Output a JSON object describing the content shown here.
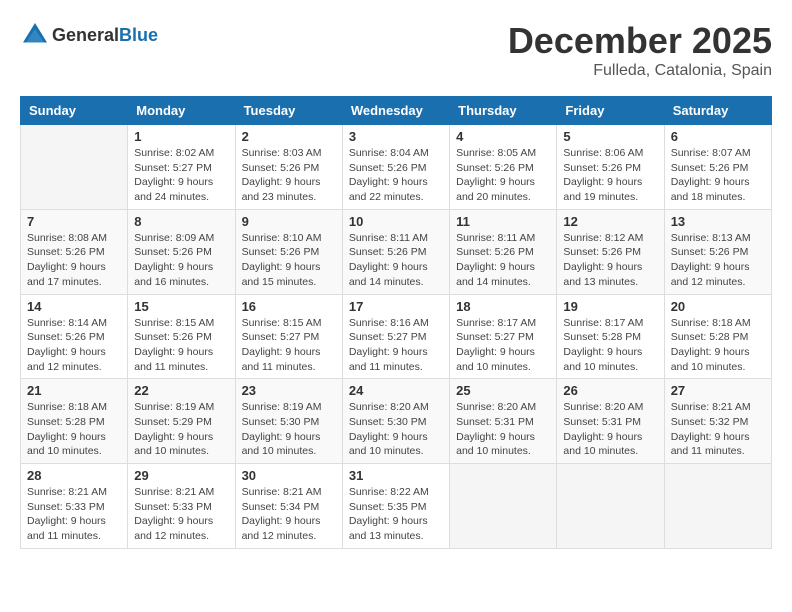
{
  "header": {
    "logo_general": "General",
    "logo_blue": "Blue",
    "month_year": "December 2025",
    "location": "Fulleda, Catalonia, Spain"
  },
  "days_of_week": [
    "Sunday",
    "Monday",
    "Tuesday",
    "Wednesday",
    "Thursday",
    "Friday",
    "Saturday"
  ],
  "weeks": [
    [
      {
        "day": "",
        "info": ""
      },
      {
        "day": "1",
        "info": "Sunrise: 8:02 AM\nSunset: 5:27 PM\nDaylight: 9 hours\nand 24 minutes."
      },
      {
        "day": "2",
        "info": "Sunrise: 8:03 AM\nSunset: 5:26 PM\nDaylight: 9 hours\nand 23 minutes."
      },
      {
        "day": "3",
        "info": "Sunrise: 8:04 AM\nSunset: 5:26 PM\nDaylight: 9 hours\nand 22 minutes."
      },
      {
        "day": "4",
        "info": "Sunrise: 8:05 AM\nSunset: 5:26 PM\nDaylight: 9 hours\nand 20 minutes."
      },
      {
        "day": "5",
        "info": "Sunrise: 8:06 AM\nSunset: 5:26 PM\nDaylight: 9 hours\nand 19 minutes."
      },
      {
        "day": "6",
        "info": "Sunrise: 8:07 AM\nSunset: 5:26 PM\nDaylight: 9 hours\nand 18 minutes."
      }
    ],
    [
      {
        "day": "7",
        "info": "Sunrise: 8:08 AM\nSunset: 5:26 PM\nDaylight: 9 hours\nand 17 minutes."
      },
      {
        "day": "8",
        "info": "Sunrise: 8:09 AM\nSunset: 5:26 PM\nDaylight: 9 hours\nand 16 minutes."
      },
      {
        "day": "9",
        "info": "Sunrise: 8:10 AM\nSunset: 5:26 PM\nDaylight: 9 hours\nand 15 minutes."
      },
      {
        "day": "10",
        "info": "Sunrise: 8:11 AM\nSunset: 5:26 PM\nDaylight: 9 hours\nand 14 minutes."
      },
      {
        "day": "11",
        "info": "Sunrise: 8:11 AM\nSunset: 5:26 PM\nDaylight: 9 hours\nand 14 minutes."
      },
      {
        "day": "12",
        "info": "Sunrise: 8:12 AM\nSunset: 5:26 PM\nDaylight: 9 hours\nand 13 minutes."
      },
      {
        "day": "13",
        "info": "Sunrise: 8:13 AM\nSunset: 5:26 PM\nDaylight: 9 hours\nand 12 minutes."
      }
    ],
    [
      {
        "day": "14",
        "info": "Sunrise: 8:14 AM\nSunset: 5:26 PM\nDaylight: 9 hours\nand 12 minutes."
      },
      {
        "day": "15",
        "info": "Sunrise: 8:15 AM\nSunset: 5:26 PM\nDaylight: 9 hours\nand 11 minutes."
      },
      {
        "day": "16",
        "info": "Sunrise: 8:15 AM\nSunset: 5:27 PM\nDaylight: 9 hours\nand 11 minutes."
      },
      {
        "day": "17",
        "info": "Sunrise: 8:16 AM\nSunset: 5:27 PM\nDaylight: 9 hours\nand 11 minutes."
      },
      {
        "day": "18",
        "info": "Sunrise: 8:17 AM\nSunset: 5:27 PM\nDaylight: 9 hours\nand 10 minutes."
      },
      {
        "day": "19",
        "info": "Sunrise: 8:17 AM\nSunset: 5:28 PM\nDaylight: 9 hours\nand 10 minutes."
      },
      {
        "day": "20",
        "info": "Sunrise: 8:18 AM\nSunset: 5:28 PM\nDaylight: 9 hours\nand 10 minutes."
      }
    ],
    [
      {
        "day": "21",
        "info": "Sunrise: 8:18 AM\nSunset: 5:28 PM\nDaylight: 9 hours\nand 10 minutes."
      },
      {
        "day": "22",
        "info": "Sunrise: 8:19 AM\nSunset: 5:29 PM\nDaylight: 9 hours\nand 10 minutes."
      },
      {
        "day": "23",
        "info": "Sunrise: 8:19 AM\nSunset: 5:30 PM\nDaylight: 9 hours\nand 10 minutes."
      },
      {
        "day": "24",
        "info": "Sunrise: 8:20 AM\nSunset: 5:30 PM\nDaylight: 9 hours\nand 10 minutes."
      },
      {
        "day": "25",
        "info": "Sunrise: 8:20 AM\nSunset: 5:31 PM\nDaylight: 9 hours\nand 10 minutes."
      },
      {
        "day": "26",
        "info": "Sunrise: 8:20 AM\nSunset: 5:31 PM\nDaylight: 9 hours\nand 10 minutes."
      },
      {
        "day": "27",
        "info": "Sunrise: 8:21 AM\nSunset: 5:32 PM\nDaylight: 9 hours\nand 11 minutes."
      }
    ],
    [
      {
        "day": "28",
        "info": "Sunrise: 8:21 AM\nSunset: 5:33 PM\nDaylight: 9 hours\nand 11 minutes."
      },
      {
        "day": "29",
        "info": "Sunrise: 8:21 AM\nSunset: 5:33 PM\nDaylight: 9 hours\nand 12 minutes."
      },
      {
        "day": "30",
        "info": "Sunrise: 8:21 AM\nSunset: 5:34 PM\nDaylight: 9 hours\nand 12 minutes."
      },
      {
        "day": "31",
        "info": "Sunrise: 8:22 AM\nSunset: 5:35 PM\nDaylight: 9 hours\nand 13 minutes."
      },
      {
        "day": "",
        "info": ""
      },
      {
        "day": "",
        "info": ""
      },
      {
        "day": "",
        "info": ""
      }
    ]
  ]
}
